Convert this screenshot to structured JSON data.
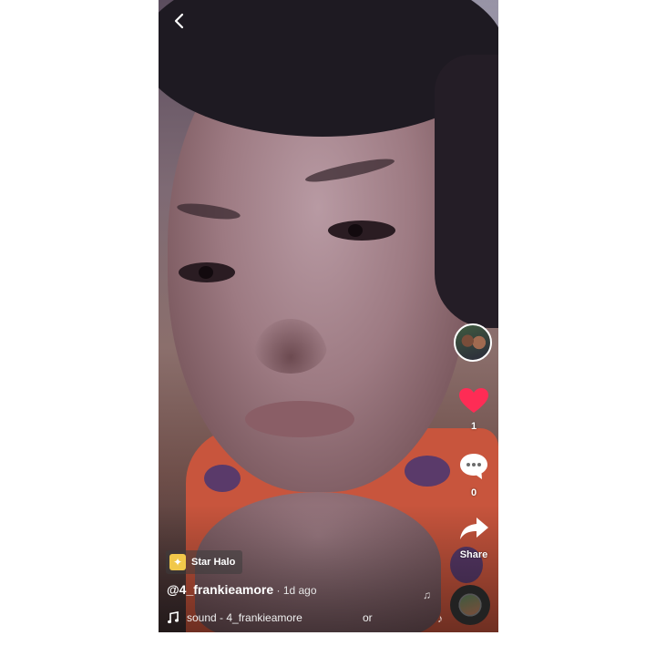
{
  "effect": {
    "icon": "wand-sparkle-icon",
    "name": "Star Halo"
  },
  "post": {
    "username": "@4_frankieamore",
    "separator": " · ",
    "age": "1d ago"
  },
  "sound": {
    "icon": "music-note-icon",
    "text": "sound - 4_frankieamore",
    "overflow": "or"
  },
  "actions": {
    "like": {
      "icon": "heart-icon",
      "count": "1",
      "color": "#fe2c55"
    },
    "comment": {
      "icon": "comment-icon",
      "count": "0"
    },
    "share": {
      "icon": "share-arrow-icon",
      "label": "Share"
    }
  },
  "nav": {
    "back_icon": "chevron-left-icon"
  }
}
